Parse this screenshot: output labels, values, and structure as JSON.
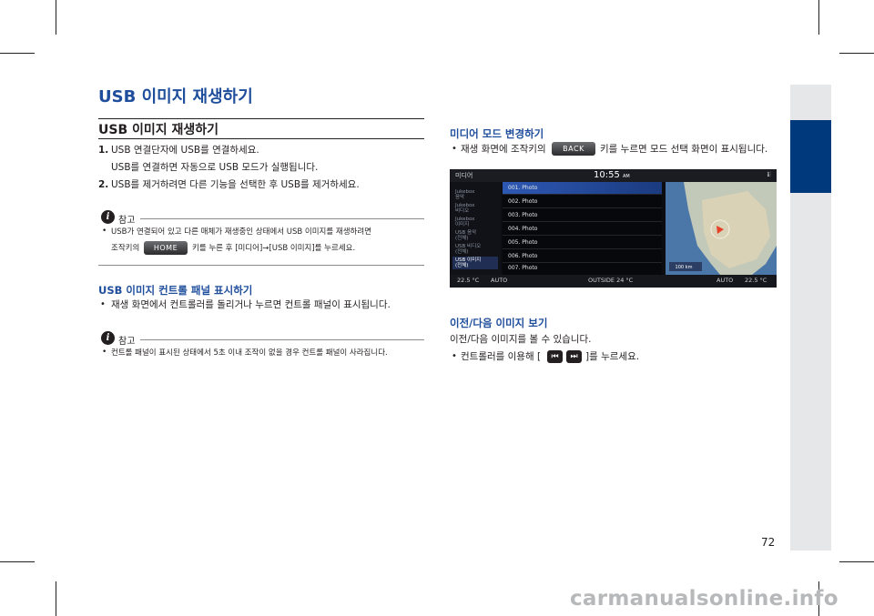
{
  "page_title": "USB 이미지 재생하기",
  "left": {
    "section_title": "USB 이미지 재생하기",
    "steps": [
      {
        "num": "1.",
        "text": "USB 연결단자에 USB를 연결하세요."
      },
      {
        "num": "",
        "text": "USB를 연결하면 자동으로 USB 모드가 실행됩니다."
      },
      {
        "num": "2.",
        "text": "USB를 제거하려면 다른 기능을 선택한 후 USB를 제거하세요."
      }
    ],
    "note1": {
      "label": "참고",
      "line1": "USB가 연결되어 있고 다른 매체가 재생중인 상태에서 USB 이미지를 재생하려면",
      "line2_pre": "조작키의",
      "key": "HOME",
      "line2_post": "키를 누른 후  [미디어]→[USB 이미지]를 누르세요."
    },
    "subsection_title": "USB 이미지 컨트롤 패널 표시하기",
    "bullet1": "재생 화면에서 컨트롤러를 돌리거나 누르면 컨트롤 패널이 표시됩니다.",
    "note2": {
      "label": "참고",
      "text": "컨트롤 패널이 표시된 상태에서 5초 이내 조작이 없을 경우 컨트롤 패널이 사라집니다."
    }
  },
  "right": {
    "media_title": "미디어 모드 변경하기",
    "media_bullet_pre": "재생 화면에 조작키의",
    "media_key": "BACK",
    "media_bullet_post": "키를 누르면 모드 선택 화면이 표시됩니다.",
    "screen": {
      "top_label": "미디어",
      "clock": "10:55",
      "ampm": "AM",
      "signal": "ℹ⫶",
      "menu": [
        "Jukebox\n음악",
        "Jukebox\n비디오",
        "Jukebox\n이미지",
        "USB 음악\n(전체)",
        "USB 비디오\n(전체)",
        "USB 이미지\n(전체)"
      ],
      "active_menu_index": 5,
      "list": [
        "001. Photo",
        "002. Photo",
        "003. Photo",
        "004. Photo",
        "005. Photo",
        "006. Photo",
        "007. Photo"
      ],
      "selected_index": 0,
      "bottom": {
        "left_temp": "22.5 °C",
        "left_mode": "AUTO",
        "outside": "OUTSIDE  24 °C",
        "right_mode": "AUTO",
        "right_temp": "22.5 °C"
      },
      "map_scale": "100 km"
    },
    "prevnext_title": "이전/다음 이미지 보기",
    "prevnext_text": "이전/다음 이미지를 볼 수 있습니다.",
    "prevnext_bullet_pre": "컨트롤러를 이용해 [",
    "prevnext_bullet_post": "]를 누르세요.",
    "prev_icon": "⏮",
    "next_icon": "⏭"
  },
  "page_number": "72",
  "watermark": "carmanualsonline.info",
  "colors": {
    "accent": "#1f4e9c",
    "side_tab": "#003a7d",
    "side_strip": "#e6e7e8"
  }
}
